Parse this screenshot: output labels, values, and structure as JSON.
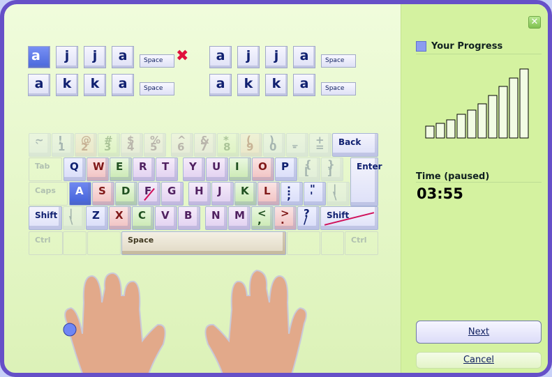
{
  "exercise": {
    "lines": [
      {
        "keys": [
          "a",
          "j",
          "j",
          "a"
        ],
        "space": "Space",
        "error": true
      },
      {
        "keys": [
          "a",
          "k",
          "k",
          "a"
        ],
        "space": "Space",
        "error": false
      }
    ],
    "reference": [
      {
        "keys": [
          "a",
          "j",
          "j",
          "a"
        ],
        "space": "Space"
      },
      {
        "keys": [
          "a",
          "k",
          "k",
          "a"
        ],
        "space": "Space"
      }
    ],
    "current_index": 0,
    "error_icon": "x-mark-icon"
  },
  "keyboard": {
    "active_key": "A",
    "rows": [
      [
        {
          "l": "~\n`",
          "c": "blue",
          "f": 1
        },
        {
          "l": "!\n1",
          "c": "blue",
          "f": 1
        },
        {
          "l": "@\n2",
          "c": "pink",
          "f": 1
        },
        {
          "l": "#\n3",
          "c": "green",
          "f": 1
        },
        {
          "l": "$\n4",
          "c": "purple",
          "f": 1
        },
        {
          "l": "%\n5",
          "c": "purple",
          "f": 1
        },
        {
          "l": "^\n6",
          "c": "purple",
          "f": 1
        },
        {
          "l": "&\n7",
          "c": "purple",
          "f": 1
        },
        {
          "l": "*\n8",
          "c": "green",
          "f": 1
        },
        {
          "l": "(\n9",
          "c": "pink",
          "f": 1
        },
        {
          "l": ")\n0",
          "c": "blue",
          "f": 1
        },
        {
          "l": "_\n-",
          "c": "blue",
          "f": 1
        },
        {
          "l": "+\n=",
          "c": "blue",
          "f": 1
        },
        {
          "l": "Back",
          "c": "plain"
        }
      ],
      [
        {
          "l": "Tab",
          "c": "ghost"
        },
        {
          "l": "Q",
          "c": "blue"
        },
        {
          "l": "W",
          "c": "pink"
        },
        {
          "l": "E",
          "c": "green"
        },
        {
          "l": "R",
          "c": "purple"
        },
        {
          "l": "T",
          "c": "purple"
        },
        {
          "l": "Y",
          "c": "purple"
        },
        {
          "l": "U",
          "c": "purple"
        },
        {
          "l": "I",
          "c": "green"
        },
        {
          "l": "O",
          "c": "pink"
        },
        {
          "l": "P",
          "c": "blue"
        },
        {
          "l": "{\n[",
          "c": "blue",
          "f": 1
        },
        {
          "l": "}\n]",
          "c": "blue",
          "f": 1
        },
        {
          "l": "Enter",
          "c": "plain"
        }
      ],
      [
        {
          "l": "Caps",
          "c": "ghost"
        },
        {
          "l": "A",
          "c": "blue"
        },
        {
          "l": "S",
          "c": "pink"
        },
        {
          "l": "D",
          "c": "green"
        },
        {
          "l": "F",
          "c": "purple",
          "strike": true
        },
        {
          "l": "G",
          "c": "purple"
        },
        {
          "l": "H",
          "c": "purple"
        },
        {
          "l": "J",
          "c": "purple"
        },
        {
          "l": "K",
          "c": "green"
        },
        {
          "l": "L",
          "c": "pink"
        },
        {
          "l": ":\n;",
          "c": "blue"
        },
        {
          "l": "\"\n'",
          "c": "blue"
        },
        {
          "l": "|\n\\",
          "c": "blue",
          "f": 1
        }
      ],
      [
        {
          "l": "Shift",
          "c": "plain"
        },
        {
          "l": "|\n\\",
          "c": "blue",
          "f": 1
        },
        {
          "l": "Z",
          "c": "blue"
        },
        {
          "l": "X",
          "c": "pink"
        },
        {
          "l": "C",
          "c": "green"
        },
        {
          "l": "V",
          "c": "purple"
        },
        {
          "l": "B",
          "c": "purple"
        },
        {
          "l": "N",
          "c": "purple"
        },
        {
          "l": "M",
          "c": "purple"
        },
        {
          "l": "<\n,",
          "c": "green"
        },
        {
          "l": ">\n.",
          "c": "pink"
        },
        {
          "l": "?\n/",
          "c": "blue"
        },
        {
          "l": "Shift",
          "c": "plain",
          "strike": true
        }
      ],
      [
        {
          "l": "Ctrl",
          "c": "ghost"
        },
        {
          "l": "",
          "c": "ghost"
        },
        {
          "l": "",
          "c": "ghost"
        },
        {
          "l": "Space",
          "c": "space"
        },
        {
          "l": "",
          "c": "ghost"
        },
        {
          "l": "",
          "c": "ghost"
        },
        {
          "l": "Ctrl",
          "c": "ghost"
        }
      ]
    ]
  },
  "guide": {
    "finger": "left-pinky"
  },
  "sidebar": {
    "close_icon": "close-icon",
    "progress_icon": "bar-chart-icon",
    "progress_title": "Your Progress",
    "progress_level": "10 of 10 bars",
    "time_label": "Time (paused)",
    "time_value": "03:55",
    "next_label": "Next",
    "cancel_label": "Cancel"
  },
  "colors": {
    "frame": "#6650c8",
    "panel": "#d4f2a0",
    "active_key": "#4a68dc",
    "error": "#e0103c"
  }
}
